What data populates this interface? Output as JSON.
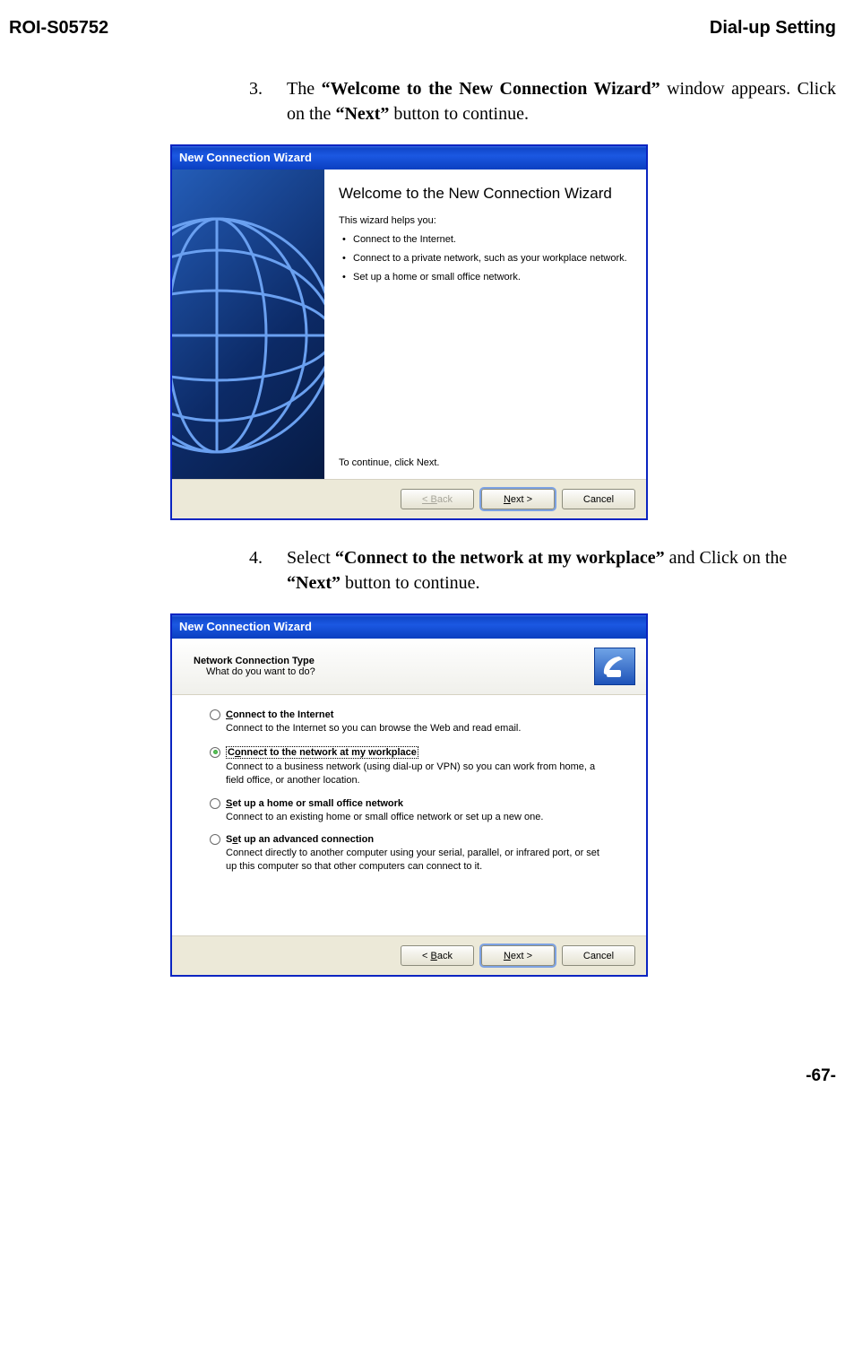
{
  "header": {
    "doc_id": "ROI-S05752",
    "section_title": "Dial-up Setting"
  },
  "steps": {
    "s3": {
      "num": "3.",
      "pre": "The ",
      "bold1": "“Welcome to the New Connection Wizard”",
      "mid1": " window appears. Click on the ",
      "bold2": "“Next”",
      "post": " button to continue."
    },
    "s4": {
      "num": "4.",
      "pre": "Select ",
      "bold1": "“Connect to the network at my workplace”",
      "mid1": " and Click on the ",
      "bold2": "“Next”",
      "post": " button to continue."
    }
  },
  "dialog1": {
    "title": "New Connection Wizard",
    "heading": "Welcome to the New Connection Wizard",
    "helps": "This wizard helps you:",
    "bullets": [
      "Connect to the Internet.",
      "Connect to a private network, such as your workplace network.",
      "Set up a home or small office network."
    ],
    "continue_text": "To continue, click Next.",
    "buttons": {
      "back": "< Back",
      "next": "Next >",
      "cancel": "Cancel"
    }
  },
  "dialog2": {
    "title": "New Connection Wizard",
    "header_bold": "Network Connection Type",
    "header_sub": "What do you want to do?",
    "options": [
      {
        "label": "Connect to the Internet",
        "desc": "Connect to the Internet so you can browse the Web and read email.",
        "checked": false,
        "focus": false
      },
      {
        "label": "Connect to the network at my workplace",
        "desc": "Connect to a business network (using dial-up or VPN) so you can work from home, a field office, or another location.",
        "checked": true,
        "focus": true
      },
      {
        "label": "Set up a home or small office network",
        "desc": "Connect to an existing home or small office network or set up a new one.",
        "checked": false,
        "focus": false
      },
      {
        "label": "Set up an advanced connection",
        "desc": "Connect directly to another computer using your serial, parallel, or infrared port, or set up this computer so that other computers can connect to it.",
        "checked": false,
        "focus": false
      }
    ],
    "buttons": {
      "back": "< Back",
      "next": "Next >",
      "cancel": "Cancel"
    }
  },
  "footer": {
    "page": "-67-"
  }
}
